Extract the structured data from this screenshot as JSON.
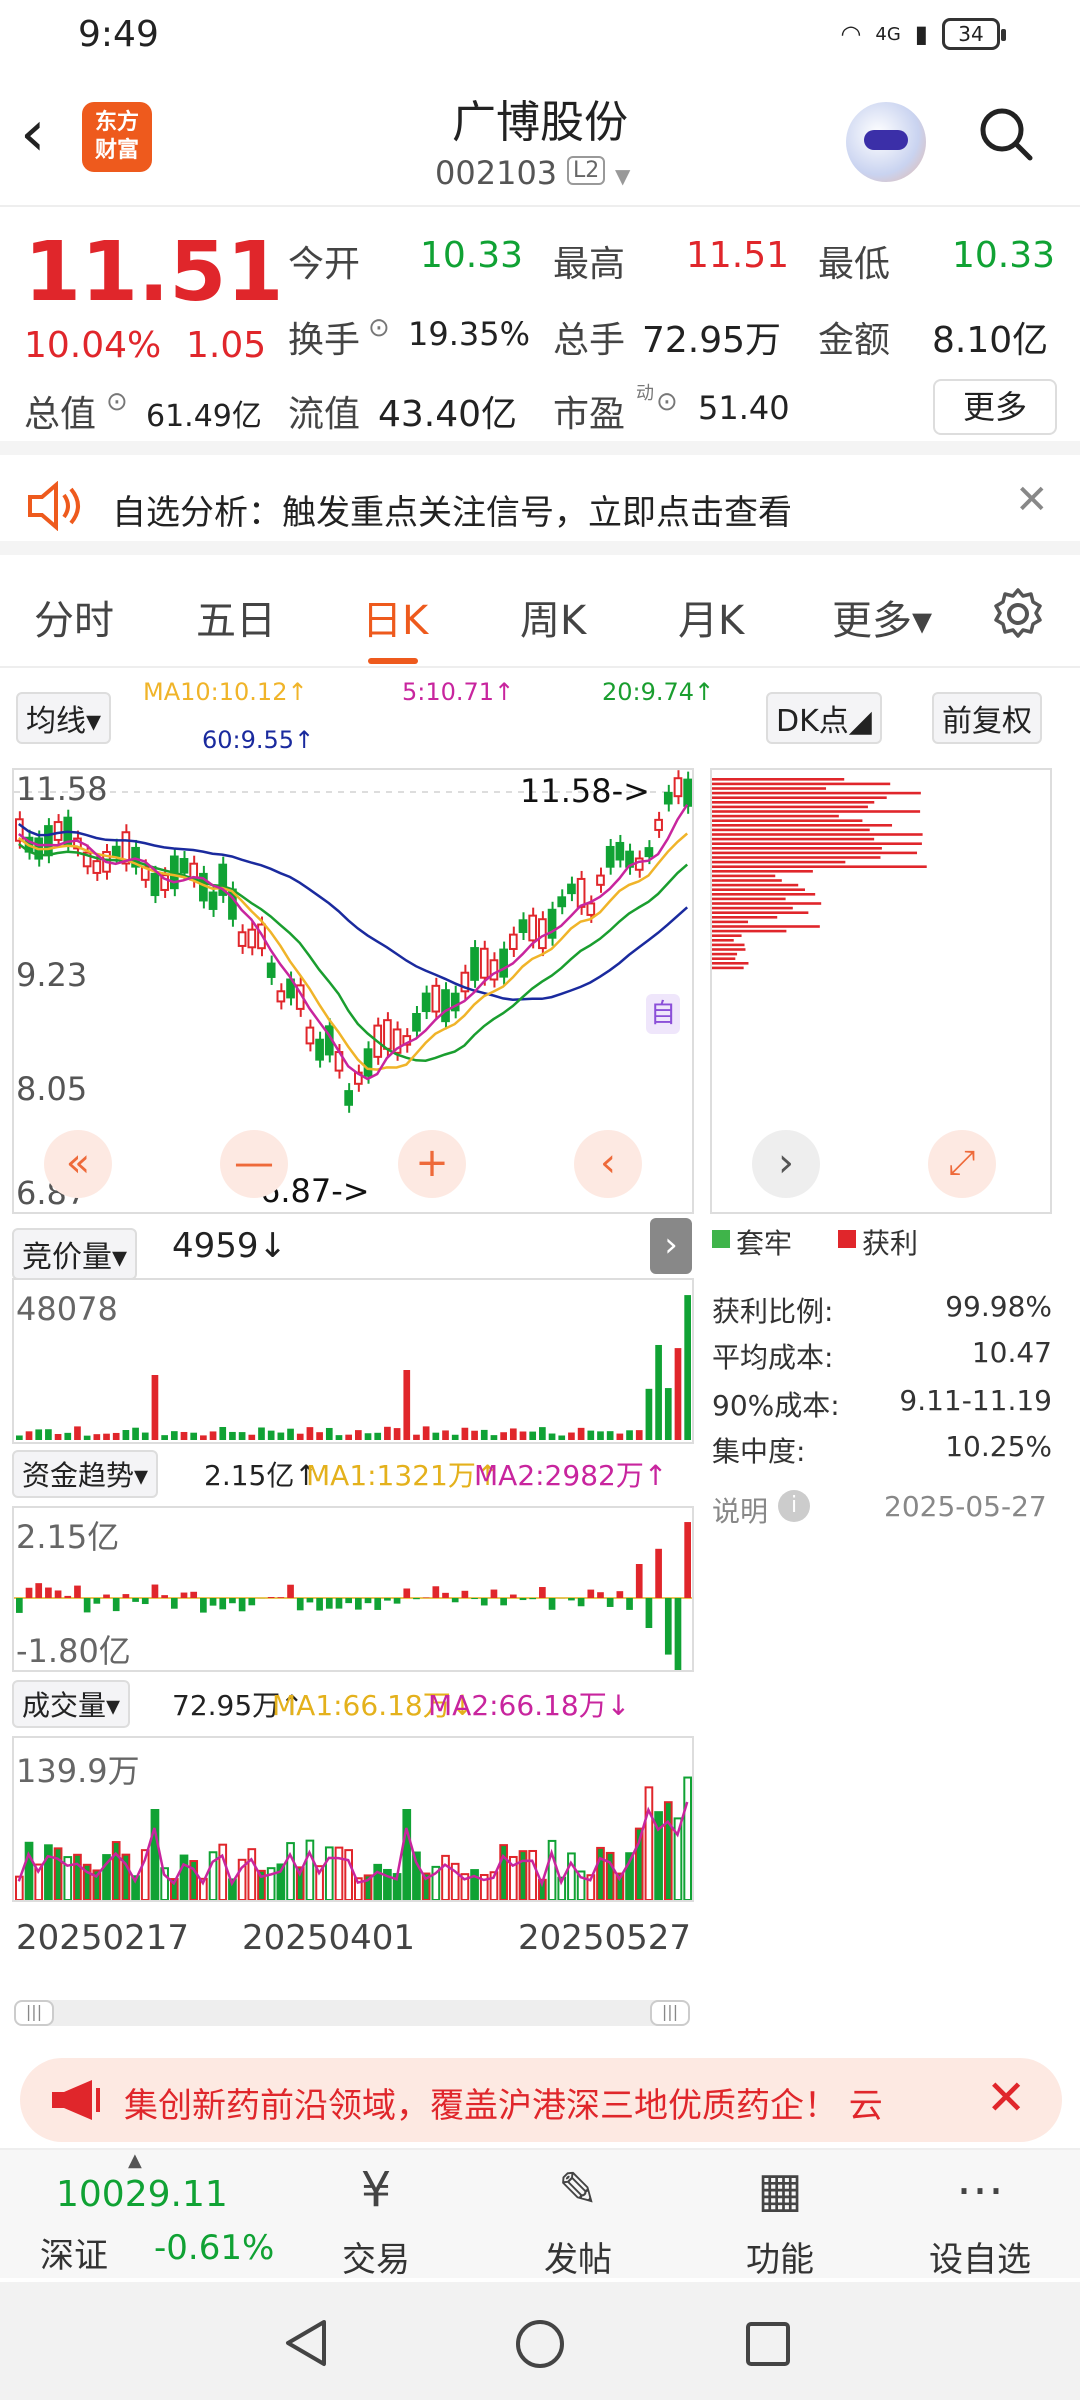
{
  "status": {
    "time": "9:49",
    "network": "4G",
    "battery": "34"
  },
  "header": {
    "back": "‹",
    "logo_line1": "东方",
    "logo_line2": "财富",
    "title": "广博股份",
    "code": "002103",
    "level": "L2"
  },
  "quote": {
    "price": "11.51",
    "pct": "10.04%",
    "change": "1.05",
    "open_label": "今开",
    "open": "10.33",
    "high_label": "最高",
    "high": "11.51",
    "low_label": "最低",
    "low": "10.33",
    "turnover_label": "换手",
    "turnover": "19.35%",
    "volume_label": "总手",
    "volume": "72.95万",
    "amount_label": "金额",
    "amount": "8.10亿",
    "mktcap_label": "总值",
    "mktcap": "61.49亿",
    "float_label": "流值",
    "float": "43.40亿",
    "pe_label": "市盈",
    "pe_sup": "动",
    "pe": "51.40",
    "more": "更多"
  },
  "alert": {
    "text": "自选分析：触发重点关注信号，立即点击查看",
    "close": "✕"
  },
  "tabs": [
    "分时",
    "五日",
    "日K",
    "周K",
    "月K",
    "更多▾"
  ],
  "active_tab": "日K",
  "chart_controls": {
    "ma_button": "均线▾",
    "ma10": "MA10:10.12↑",
    "ma5": "5:10.71↑",
    "ma20": "20:9.74↑",
    "ma60": "60:9.55↑",
    "dk_button": "DK点◢",
    "rights_button": "前复权"
  },
  "kline": {
    "y_labels": [
      "11.58",
      "9.23",
      "8.05",
      "6.87"
    ],
    "max_note": "11.58->",
    "min_note": "6.87->",
    "auto_badge": "自",
    "nav": {
      "fast_back": "«",
      "zoom_out": "—",
      "zoom_in": "+",
      "prev": "‹",
      "next": "›",
      "expand": "⤢"
    }
  },
  "chip": {
    "legend_trapped": "套牢",
    "legend_profit": "获利",
    "rows": [
      {
        "label": "获利比例:",
        "value": "99.98%"
      },
      {
        "label": "平均成本:",
        "value": "10.47"
      },
      {
        "label": "90%成本:",
        "value": "9.11-11.19"
      },
      {
        "label": "集中度:",
        "value": "10.25%"
      }
    ],
    "note_label": "说明",
    "date": "2025-05-27"
  },
  "auction": {
    "selector": "竞价量▾",
    "value": "4959↓",
    "max_label": "48078"
  },
  "capital": {
    "selector": "资金趋势▾",
    "value": "2.15亿↑",
    "ma1": "MA1:1321万↑",
    "ma2": "MA2:2982万↑",
    "max_label": "2.15亿",
    "min_label": "-1.80亿"
  },
  "volume": {
    "selector": "成交量▾",
    "value": "72.95万↑",
    "ma1": "MA1:66.18万↓",
    "ma2": "MA2:66.18万↓",
    "max_label": "139.9万"
  },
  "dates": [
    "20250217",
    "20250401",
    "20250527"
  ],
  "banner": {
    "text": "集创新药前沿领域，覆盖沪港深三地优质药企！ 云",
    "close": "✕"
  },
  "bottom_nav": {
    "index_value": "10029.11",
    "index_name": "深证",
    "index_pct": "-0.61%",
    "items": [
      {
        "icon": "trade-icon",
        "label": "交易"
      },
      {
        "icon": "post-icon",
        "label": "发帖"
      },
      {
        "icon": "function-icon",
        "label": "功能"
      },
      {
        "icon": "watchlist-icon",
        "label": "设自选"
      }
    ]
  },
  "colors": {
    "up": "#e0262b",
    "down": "#10a234",
    "accent": "#ee5a1d",
    "ma5": "#c8259e",
    "ma10": "#f0b429",
    "ma20": "#1a9e2f",
    "ma60": "#1a2a9e"
  }
}
